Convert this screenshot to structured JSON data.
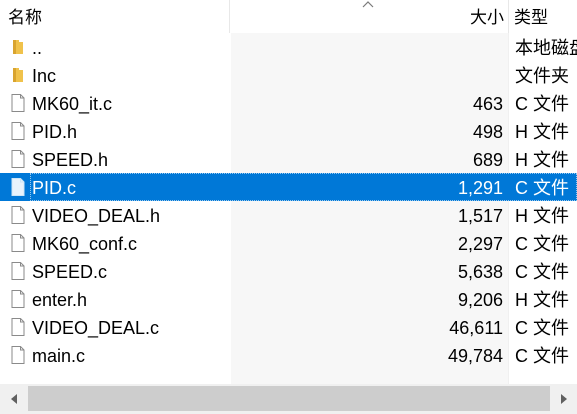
{
  "header": {
    "name_label": "名称",
    "size_label": "大小",
    "type_label": "类型"
  },
  "files": [
    {
      "name": "..",
      "size": "",
      "type": "本地磁盘",
      "icon": "folder-icon",
      "selected": false
    },
    {
      "name": "Inc",
      "size": "",
      "type": "文件夹",
      "icon": "folder-icon",
      "selected": false
    },
    {
      "name": "MK60_it.c",
      "size": "463",
      "type": "C 文件",
      "icon": "file-icon",
      "selected": false
    },
    {
      "name": "PID.h",
      "size": "498",
      "type": "H 文件",
      "icon": "file-icon",
      "selected": false
    },
    {
      "name": "SPEED.h",
      "size": "689",
      "type": "H 文件",
      "icon": "file-icon",
      "selected": false
    },
    {
      "name": "PID.c",
      "size": "1,291",
      "type": "C 文件",
      "icon": "file-icon",
      "selected": true
    },
    {
      "name": "VIDEO_DEAL.h",
      "size": "1,517",
      "type": "H 文件",
      "icon": "file-icon",
      "selected": false
    },
    {
      "name": "MK60_conf.c",
      "size": "2,297",
      "type": "C 文件",
      "icon": "file-icon",
      "selected": false
    },
    {
      "name": "SPEED.c",
      "size": "5,638",
      "type": "C 文件",
      "icon": "file-icon",
      "selected": false
    },
    {
      "name": "enter.h",
      "size": "9,206",
      "type": "H 文件",
      "icon": "file-icon",
      "selected": false
    },
    {
      "name": "VIDEO_DEAL.c",
      "size": "46,611",
      "type": "C 文件",
      "icon": "file-icon",
      "selected": false
    },
    {
      "name": "main.c",
      "size": "49,784",
      "type": "C 文件",
      "icon": "file-icon",
      "selected": false
    }
  ],
  "colors": {
    "selection": "#0078d7",
    "folder": "#f0c24b",
    "scroll_thumb": "#cdcdcd"
  }
}
